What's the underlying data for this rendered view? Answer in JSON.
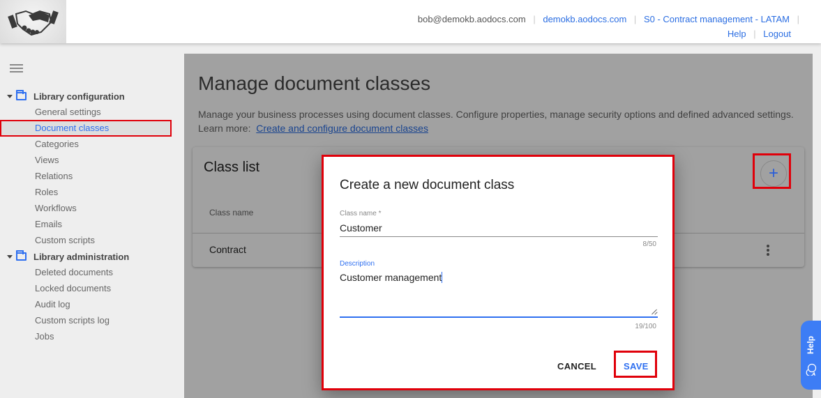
{
  "header": {
    "user_email": "bob@demokb.aodocs.com",
    "domain_link": "demokb.aodocs.com",
    "library_link": "S0 - Contract management - LATAM",
    "help_link": "Help",
    "logout_link": "Logout",
    "logo_icon": "handshake-icon"
  },
  "sidebar": {
    "menu_icon": "hamburger-menu-icon",
    "sections": [
      {
        "label": "Library configuration",
        "icon": "folder-icon",
        "items": [
          {
            "label": "General settings"
          },
          {
            "label": "Document classes",
            "active": true
          },
          {
            "label": "Categories"
          },
          {
            "label": "Views"
          },
          {
            "label": "Relations"
          },
          {
            "label": "Roles"
          },
          {
            "label": "Workflows"
          },
          {
            "label": "Emails"
          },
          {
            "label": "Custom scripts"
          }
        ]
      },
      {
        "label": "Library administration",
        "icon": "folder-icon",
        "items": [
          {
            "label": "Deleted documents"
          },
          {
            "label": "Locked documents"
          },
          {
            "label": "Audit log"
          },
          {
            "label": "Custom scripts log"
          },
          {
            "label": "Jobs"
          }
        ]
      }
    ]
  },
  "main": {
    "title": "Manage document classes",
    "description": "Manage your business processes using document classes. Configure properties, manage security options and defined advanced settings.",
    "learn_more_prefix": "Learn more:",
    "learn_more_link": "Create and configure document classes",
    "class_list": {
      "title": "Class list",
      "add_button_icon": "+",
      "column_header": "Class name",
      "rows": [
        {
          "name": "Contract",
          "menu_icon": "more-vert-icon"
        }
      ]
    }
  },
  "dialog": {
    "title": "Create a new document class",
    "class_name": {
      "label": "Class name *",
      "value": "Customer",
      "counter": "8/50"
    },
    "description": {
      "label": "Description",
      "value": "Customer management",
      "counter": "19/100"
    },
    "cancel_label": "CANCEL",
    "save_label": "SAVE"
  },
  "help_widget": {
    "label": "Help"
  },
  "colors": {
    "accent": "#2e6ff0",
    "link": "#2a6de2",
    "highlight_box": "#e0000a",
    "help_tab": "#3d7df5"
  }
}
